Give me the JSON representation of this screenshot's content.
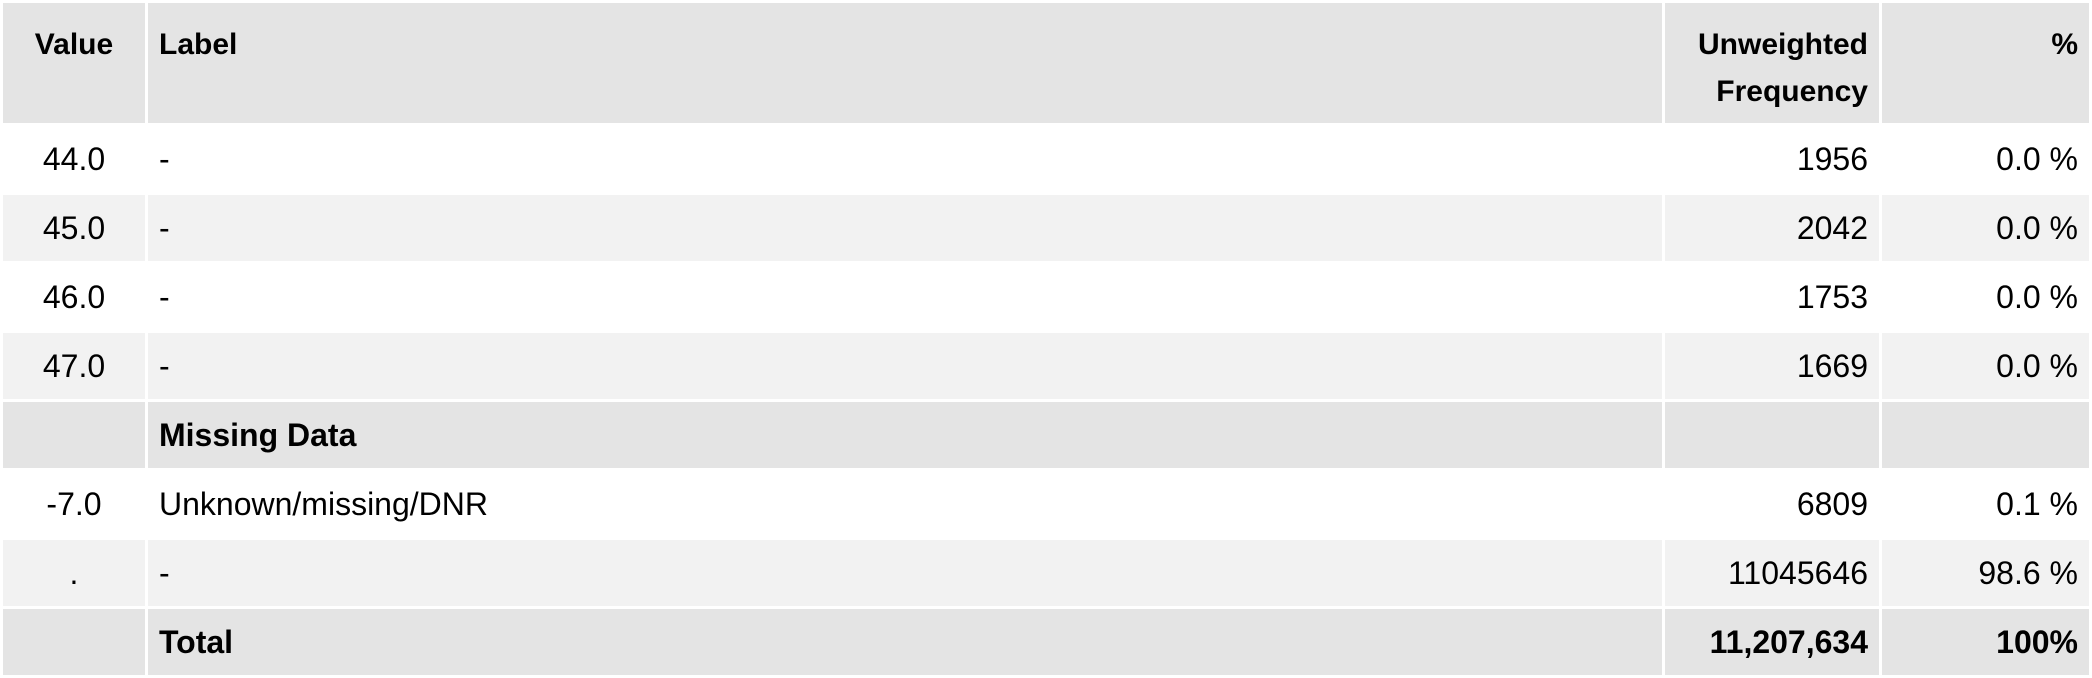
{
  "table": {
    "headers": {
      "value": "Value",
      "label": "Label",
      "frequency": "Unweighted Frequency",
      "percent": "%"
    },
    "rows": [
      {
        "value": "44.0",
        "label": "-",
        "frequency": "1956",
        "percent": "0.0 %"
      },
      {
        "value": "45.0",
        "label": "-",
        "frequency": "2042",
        "percent": "0.0 %"
      },
      {
        "value": "46.0",
        "label": "-",
        "frequency": "1753",
        "percent": "0.0 %"
      },
      {
        "value": "47.0",
        "label": "-",
        "frequency": "1669",
        "percent": "0.0 %"
      }
    ],
    "missing_section_label": "Missing Data",
    "missing_rows": [
      {
        "value": "-7.0",
        "label": "Unknown/missing/DNR",
        "frequency": "6809",
        "percent": "0.1 %"
      },
      {
        "value": ".",
        "label": "-",
        "frequency": "11045646",
        "percent": "98.6 %"
      }
    ],
    "total": {
      "label": "Total",
      "frequency": "11,207,634",
      "percent": "100%"
    }
  }
}
